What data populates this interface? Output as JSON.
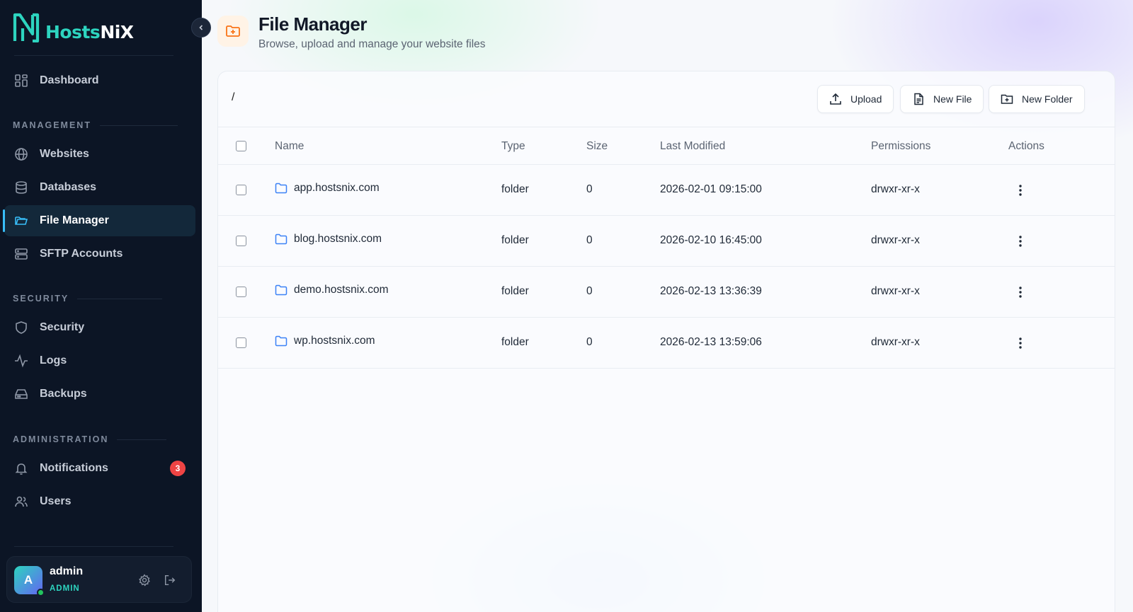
{
  "brand": {
    "name_part1": "Hosts",
    "name_part2": "NiX"
  },
  "sidebar": {
    "dashboard": {
      "label": "Dashboard"
    },
    "sections": {
      "management": "MANAGEMENT",
      "security": "SECURITY",
      "administration": "ADMINISTRATION"
    },
    "items": {
      "websites": "Websites",
      "databases": "Databases",
      "file_manager": "File Manager",
      "sftp": "SFTP Accounts",
      "security": "Security",
      "logs": "Logs",
      "backups": "Backups",
      "notifications": "Notifications",
      "users": "Users"
    },
    "notifications_badge": "3",
    "active_item": "file_manager"
  },
  "user": {
    "initial": "A",
    "name": "admin",
    "role": "ADMIN",
    "status": "online"
  },
  "header": {
    "title": "File Manager",
    "subtitle": "Browse, upload and manage your website files"
  },
  "toolbar": {
    "path": "/",
    "upload_label": "Upload",
    "new_file_label": "New File",
    "new_folder_label": "New Folder"
  },
  "table": {
    "columns": {
      "name": "Name",
      "type": "Type",
      "size": "Size",
      "modified": "Last Modified",
      "permissions": "Permissions",
      "actions": "Actions"
    },
    "rows": [
      {
        "name": "app.hostsnix.com",
        "type": "folder",
        "size": "0",
        "modified": "2026-02-01 09:15:00",
        "permissions": "drwxr-xr-x"
      },
      {
        "name": "blog.hostsnix.com",
        "type": "folder",
        "size": "0",
        "modified": "2026-02-10 16:45:00",
        "permissions": "drwxr-xr-x"
      },
      {
        "name": "demo.hostsnix.com",
        "type": "folder",
        "size": "0",
        "modified": "2026-02-13 13:36:39",
        "permissions": "drwxr-xr-x"
      },
      {
        "name": "wp.hostsnix.com",
        "type": "folder",
        "size": "0",
        "modified": "2026-02-13 13:59:06",
        "permissions": "drwxr-xr-x"
      }
    ]
  },
  "colors": {
    "sidebar_bg": "#0c1525",
    "accent_teal": "#2dd4bf",
    "active_indicator": "#38bdf8",
    "badge_red": "#ef4444",
    "folder_icon": "#3b82f6",
    "title_icon": "#f97316"
  }
}
